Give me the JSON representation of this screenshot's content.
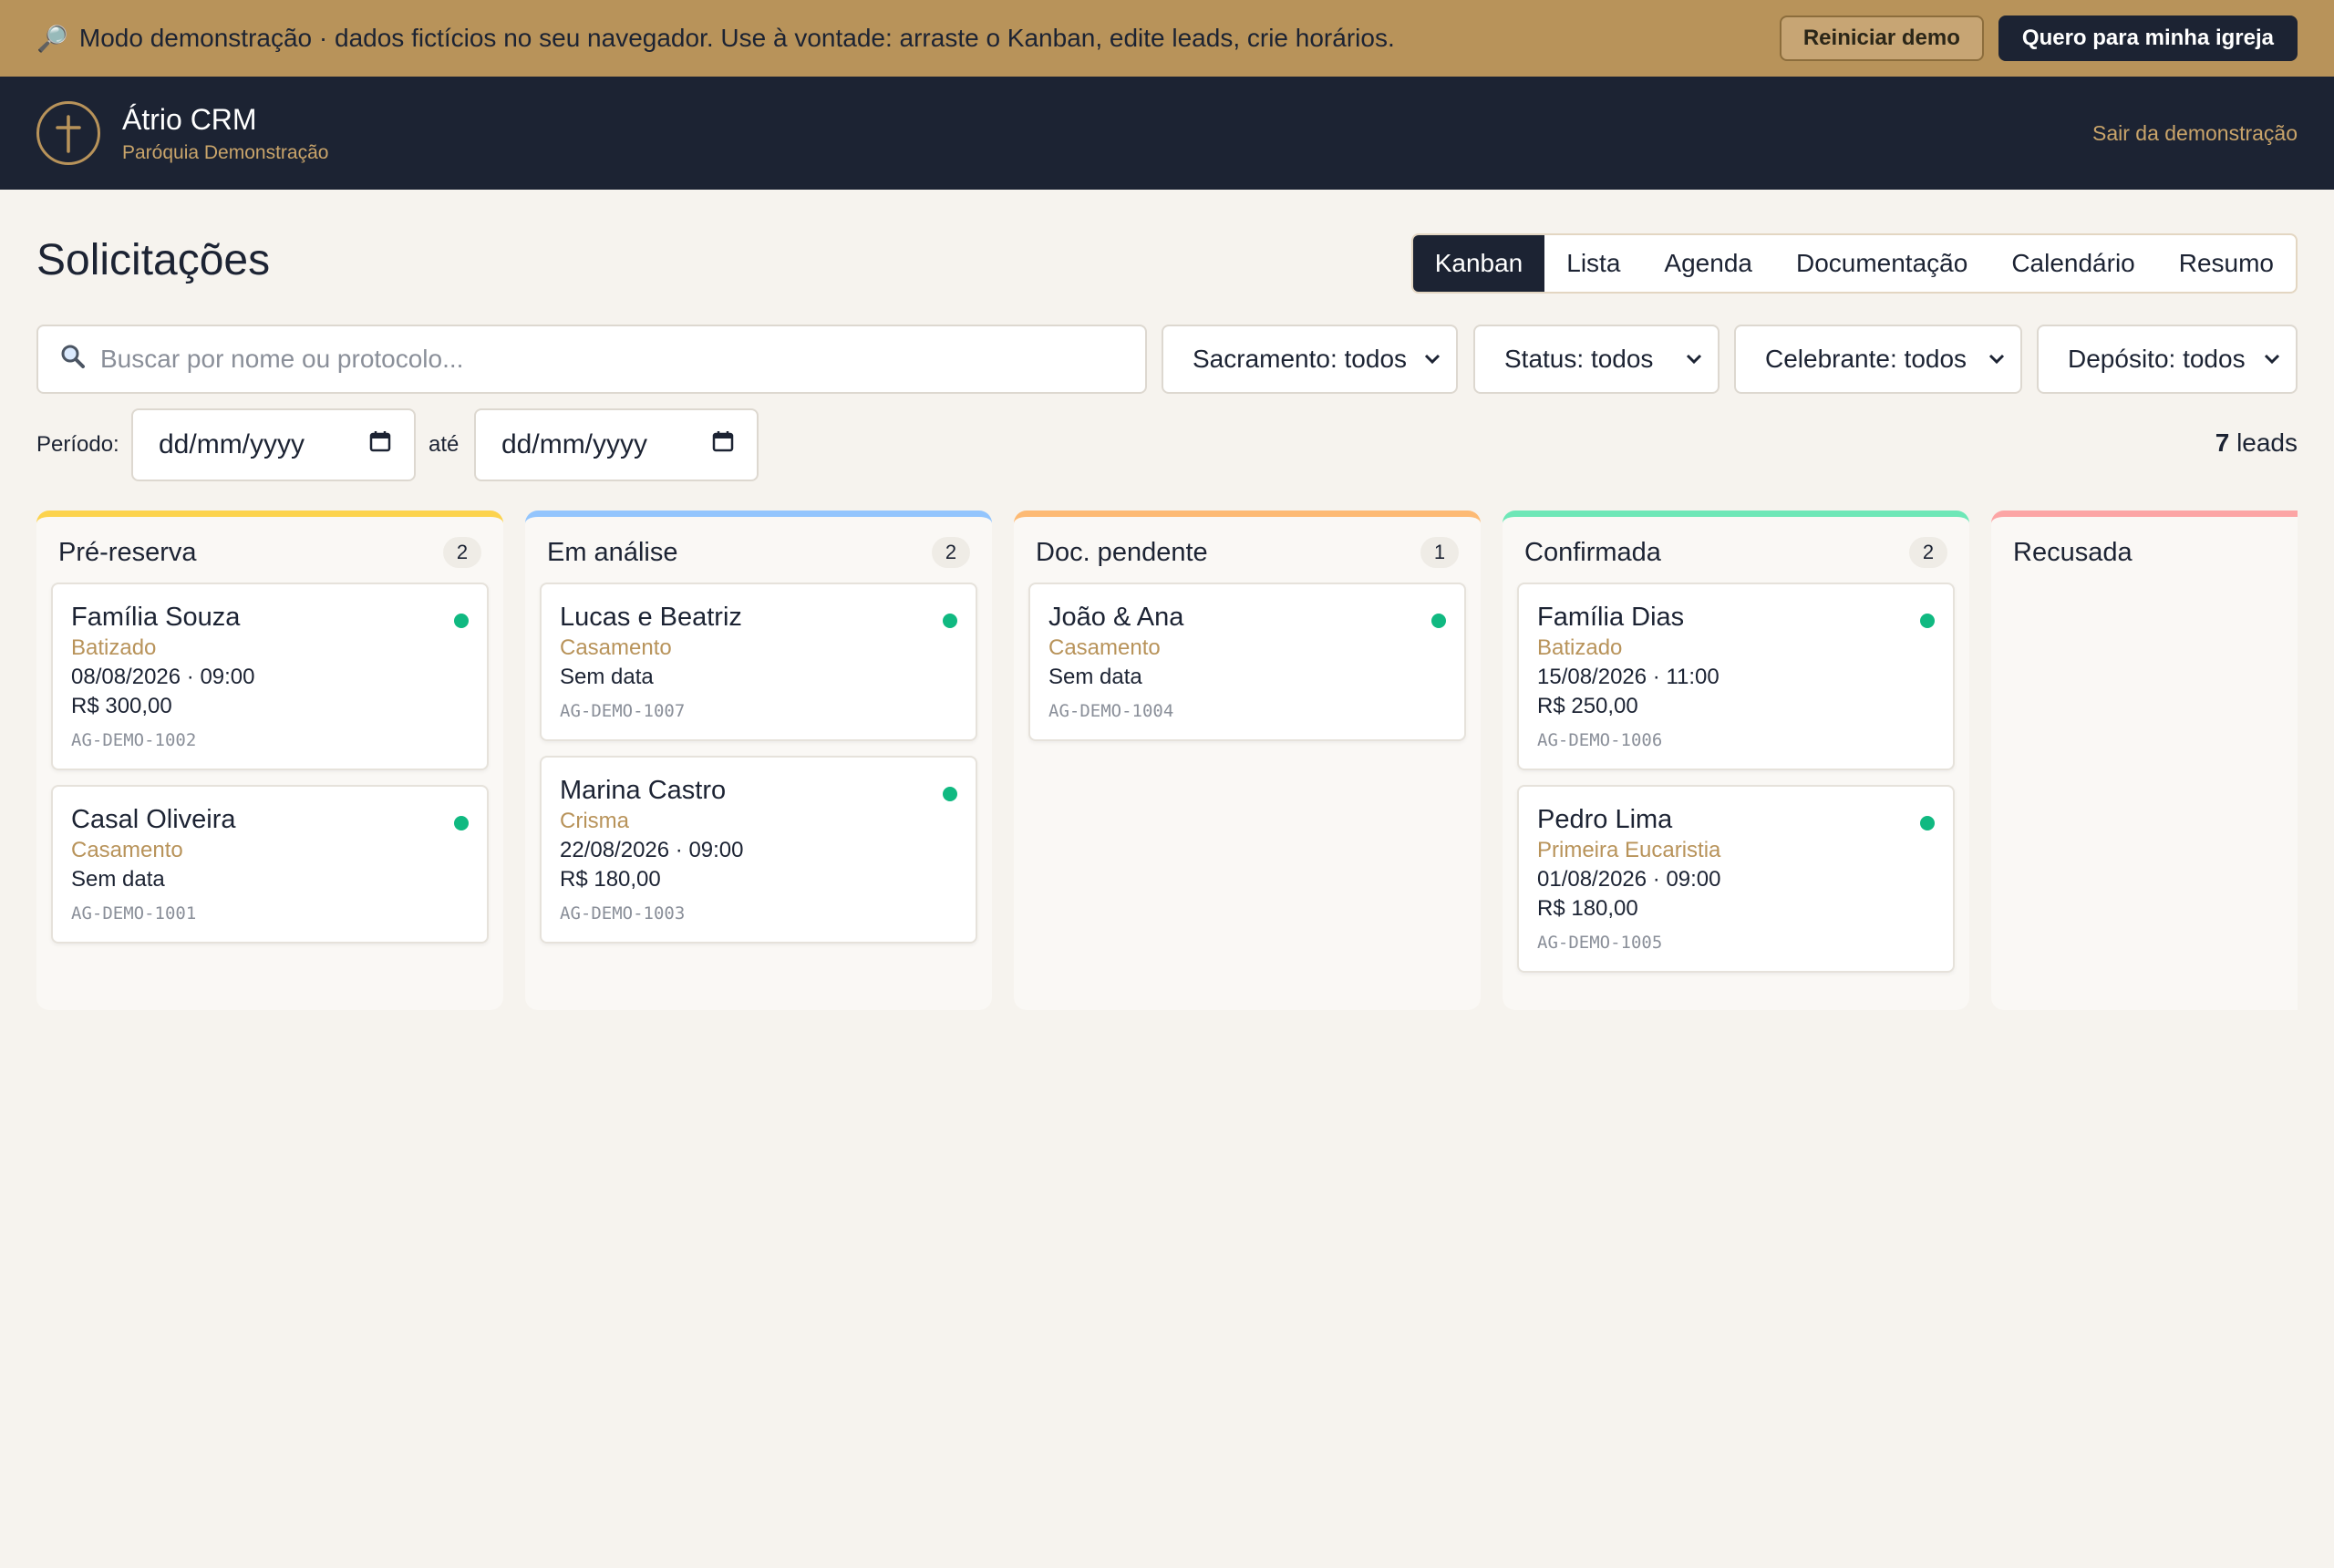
{
  "demo_banner": {
    "icon": "🔎",
    "text": "Modo demonstração · dados fictícios no seu navegador. Use à vontade: arraste o Kanban, edite leads, crie horários.",
    "reset_label": "Reiniciar demo",
    "cta_label": "Quero para minha igreja"
  },
  "header": {
    "app_name": "Átrio CRM",
    "parish": "Paróquia Demonstração",
    "exit_label": "Sair da demonstração"
  },
  "page": {
    "title": "Solicitações"
  },
  "view_tabs": [
    {
      "label": "Kanban",
      "active": true
    },
    {
      "label": "Lista"
    },
    {
      "label": "Agenda"
    },
    {
      "label": "Documentação"
    },
    {
      "label": "Calendário"
    },
    {
      "label": "Resumo"
    }
  ],
  "filters": {
    "search_placeholder": "Buscar por nome ou protocolo...",
    "sacramento": "Sacramento: todos",
    "status": "Status: todos",
    "celebrante": "Celebrante: todos",
    "deposito": "Depósito: todos",
    "period_label": "Período:",
    "date_from": "dd/mm/yyyy",
    "until_label": "até",
    "date_to": "dd/mm/yyyy"
  },
  "lead_count": {
    "number": "7",
    "label": "leads"
  },
  "colors": {
    "accent": "#b8935a",
    "navy": "#1c2333",
    "status_dot": "#10b981",
    "pre_reserva": "#fcd34d",
    "em_analise": "#93c5fd",
    "doc_pendente": "#fdba74",
    "confirmada": "#6ee7b7",
    "recusada": "#fca5a5"
  },
  "kanban": {
    "columns": [
      {
        "title": "Pré-reserva",
        "count": "2",
        "cards": [
          {
            "name": "Família Souza",
            "sacrament": "Batizado",
            "date": "08/08/2026 · 09:00",
            "amount": "R$ 300,00",
            "protocol": "AG-DEMO-1002"
          },
          {
            "name": "Casal Oliveira",
            "sacrament": "Casamento",
            "date": "Sem data",
            "protocol": "AG-DEMO-1001"
          }
        ]
      },
      {
        "title": "Em análise",
        "count": "2",
        "cards": [
          {
            "name": "Lucas e Beatriz",
            "sacrament": "Casamento",
            "date": "Sem data",
            "protocol": "AG-DEMO-1007"
          },
          {
            "name": "Marina Castro",
            "sacrament": "Crisma",
            "date": "22/08/2026 · 09:00",
            "amount": "R$ 180,00",
            "protocol": "AG-DEMO-1003"
          }
        ]
      },
      {
        "title": "Doc. pendente",
        "count": "1",
        "cards": [
          {
            "name": "João & Ana",
            "sacrament": "Casamento",
            "date": "Sem data",
            "protocol": "AG-DEMO-1004"
          }
        ]
      },
      {
        "title": "Confirmada",
        "count": "2",
        "cards": [
          {
            "name": "Família Dias",
            "sacrament": "Batizado",
            "date": "15/08/2026 · 11:00",
            "amount": "R$ 250,00",
            "protocol": "AG-DEMO-1006"
          },
          {
            "name": "Pedro Lima",
            "sacrament": "Primeira Eucaristia",
            "date": "01/08/2026 · 09:00",
            "amount": "R$ 180,00",
            "protocol": "AG-DEMO-1005"
          }
        ]
      },
      {
        "title": "Recusada",
        "cards": []
      }
    ]
  }
}
